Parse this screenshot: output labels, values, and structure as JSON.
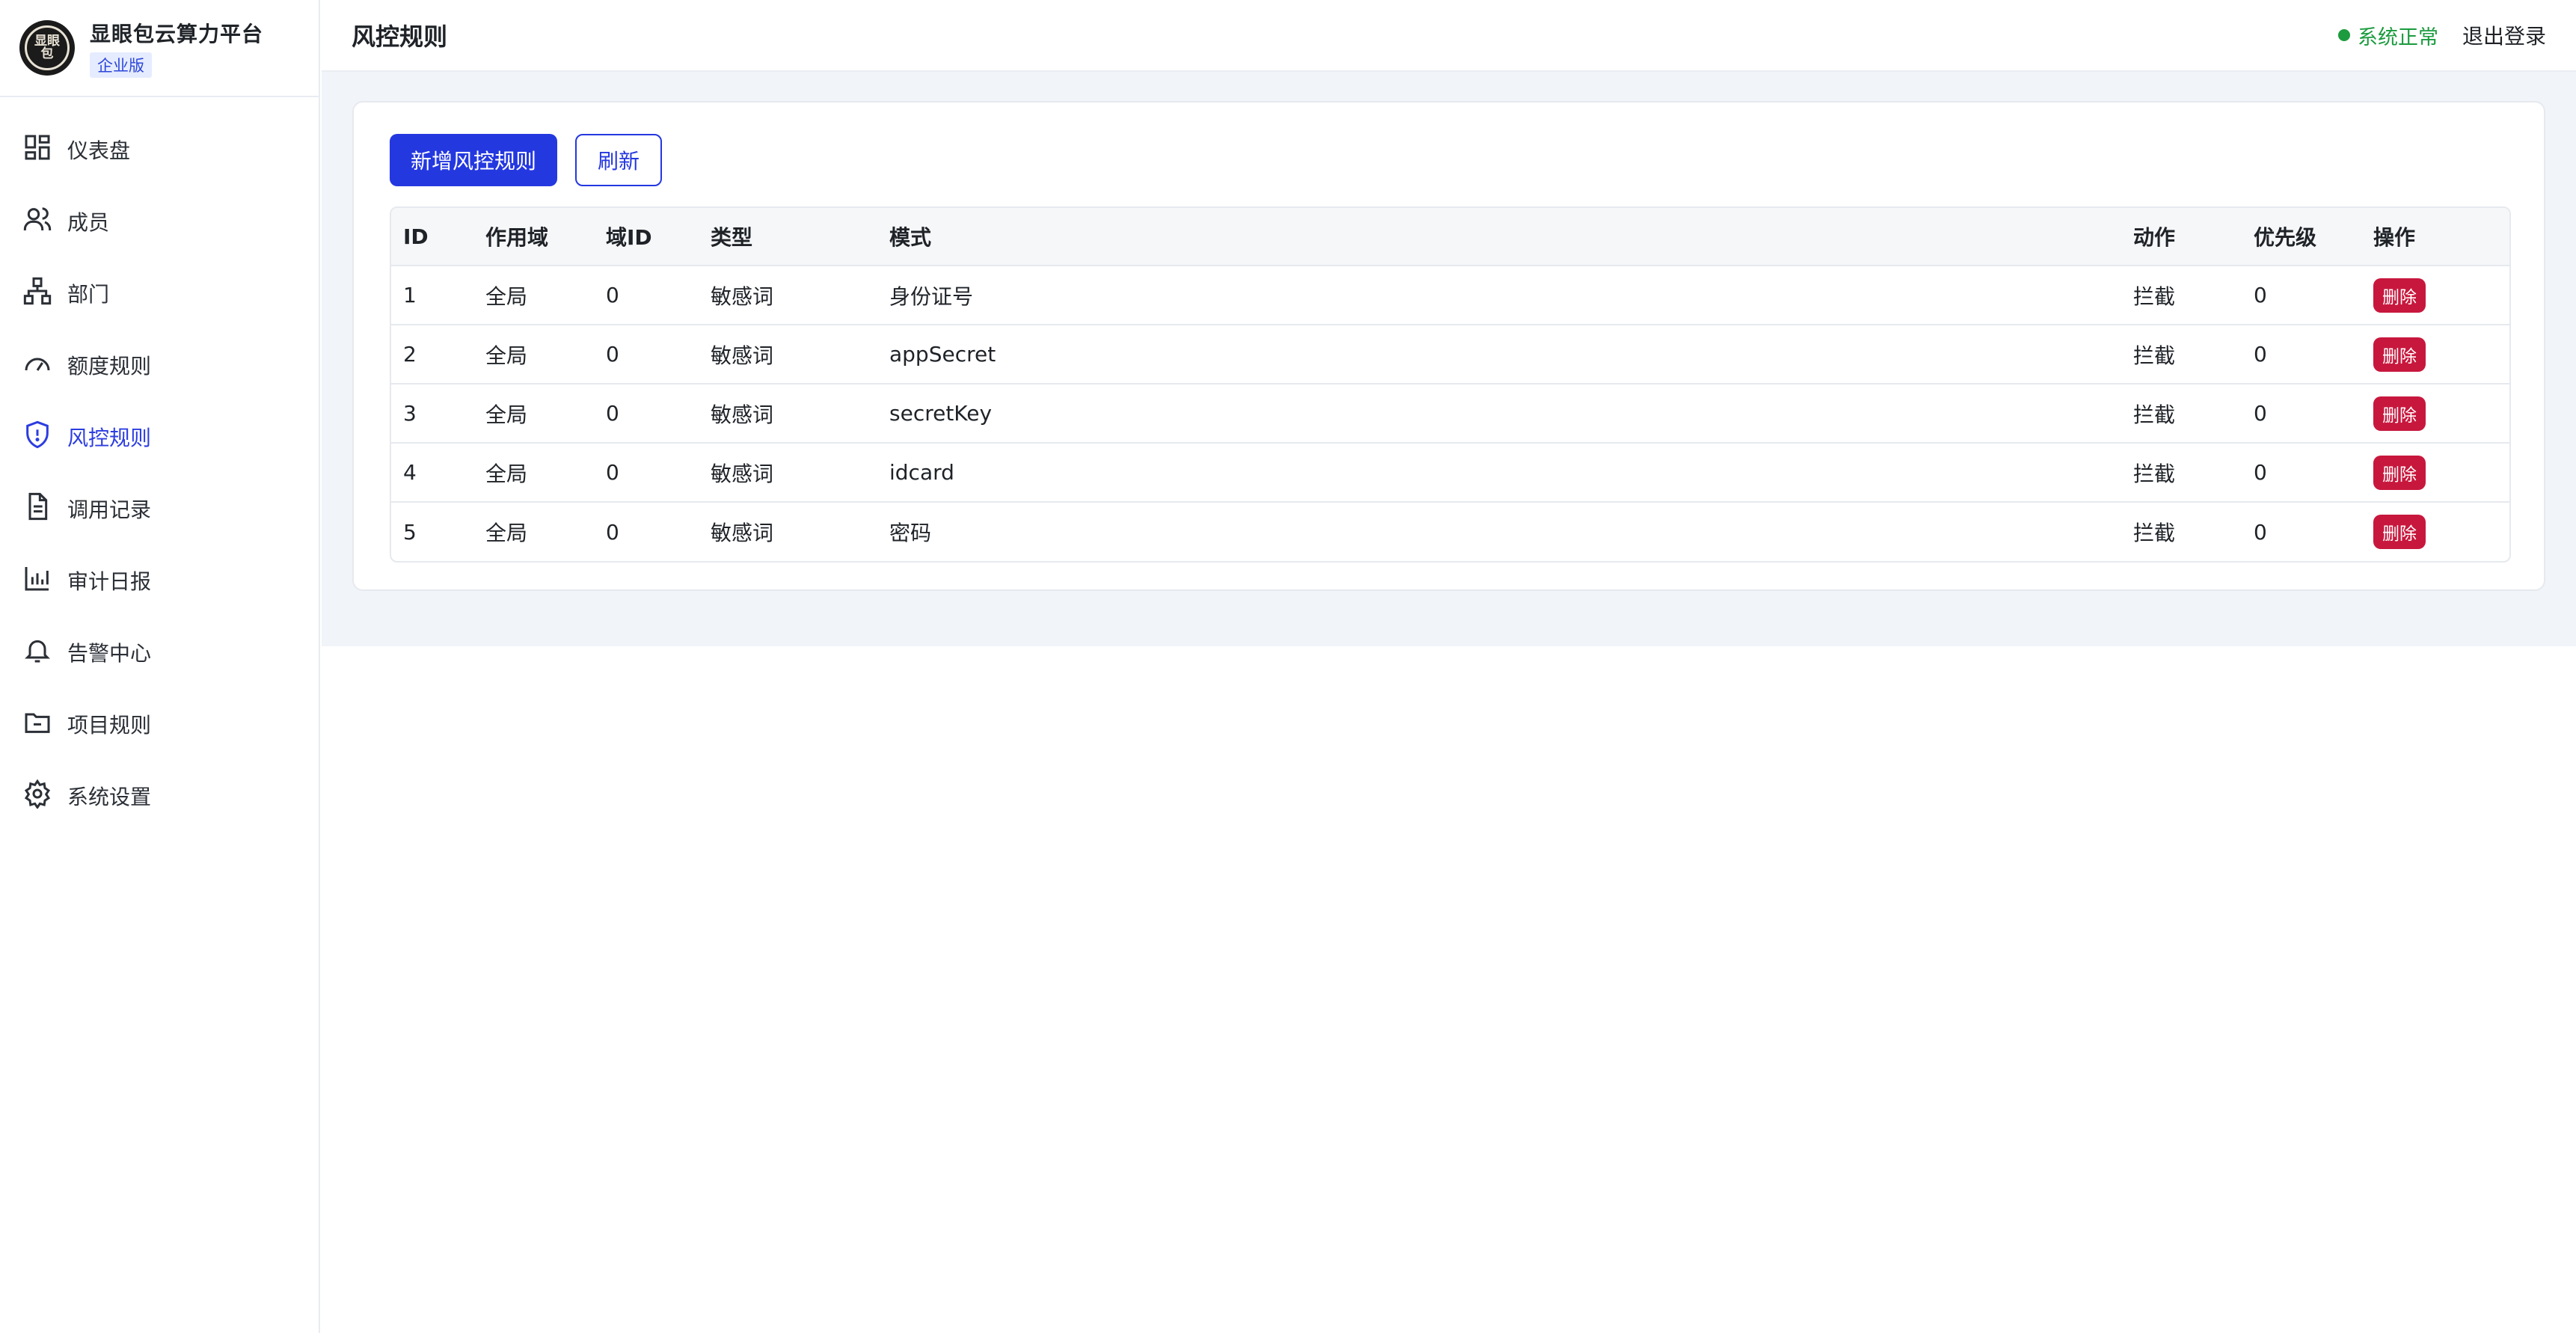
{
  "brand": {
    "logo_text": "显眼\n包",
    "name": "显眼包云算力平台",
    "edition": "企业版"
  },
  "sidebar": {
    "items": [
      {
        "label": "仪表盘",
        "icon": "dashboard-icon",
        "active": false
      },
      {
        "label": "成员",
        "icon": "users-icon",
        "active": false
      },
      {
        "label": "部门",
        "icon": "org-chart-icon",
        "active": false
      },
      {
        "label": "额度规则",
        "icon": "gauge-icon",
        "active": false
      },
      {
        "label": "风控规则",
        "icon": "shield-alert-icon",
        "active": true
      },
      {
        "label": "调用记录",
        "icon": "document-icon",
        "active": false
      },
      {
        "label": "审计日报",
        "icon": "bar-chart-icon",
        "active": false
      },
      {
        "label": "告警中心",
        "icon": "bell-icon",
        "active": false
      },
      {
        "label": "项目规则",
        "icon": "folder-minus-icon",
        "active": false
      },
      {
        "label": "系统设置",
        "icon": "gear-icon",
        "active": false
      }
    ]
  },
  "header": {
    "title": "风控规则",
    "status": "系统正常",
    "logout": "退出登录"
  },
  "toolbar": {
    "add_label": "新增风控规则",
    "refresh_label": "刷新"
  },
  "table": {
    "columns": [
      "ID",
      "作用域",
      "域ID",
      "类型",
      "模式",
      "动作",
      "优先级",
      "操作"
    ],
    "rows": [
      {
        "id": "1",
        "scope": "全局",
        "domain_id": "0",
        "type": "敏感词",
        "pattern": "身份证号",
        "action": "拦截",
        "priority": "0",
        "op": "删除"
      },
      {
        "id": "2",
        "scope": "全局",
        "domain_id": "0",
        "type": "敏感词",
        "pattern": "appSecret",
        "action": "拦截",
        "priority": "0",
        "op": "删除"
      },
      {
        "id": "3",
        "scope": "全局",
        "domain_id": "0",
        "type": "敏感词",
        "pattern": "secretKey",
        "action": "拦截",
        "priority": "0",
        "op": "删除"
      },
      {
        "id": "4",
        "scope": "全局",
        "domain_id": "0",
        "type": "敏感词",
        "pattern": "idcard",
        "action": "拦截",
        "priority": "0",
        "op": "删除"
      },
      {
        "id": "5",
        "scope": "全局",
        "domain_id": "0",
        "type": "敏感词",
        "pattern": "密码",
        "action": "拦截",
        "priority": "0",
        "op": "删除"
      }
    ]
  },
  "colors": {
    "accent": "#2438e0",
    "status_ok": "#1c9b3f",
    "danger": "#c8173d"
  }
}
